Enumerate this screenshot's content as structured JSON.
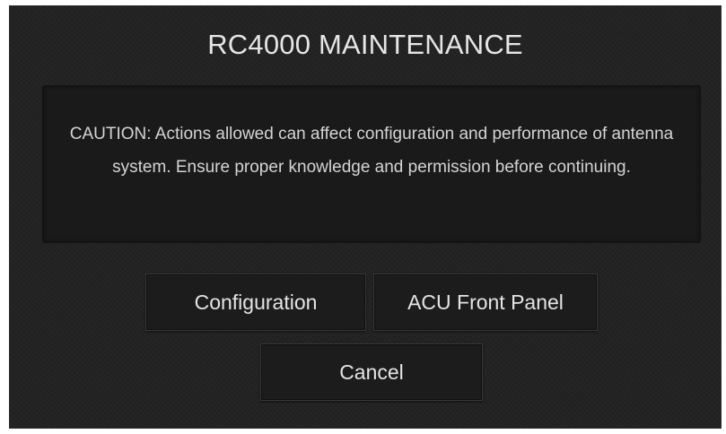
{
  "dialog": {
    "title": "RC4000 MAINTENANCE",
    "caution": "CAUTION: Actions allowed can affect configuration and performance of antenna system. Ensure proper knowledge and permission before continuing.",
    "buttons": {
      "configuration": "Configuration",
      "acu_front_panel": "ACU Front Panel",
      "cancel": "Cancel"
    }
  },
  "colors": {
    "dialog_background": "#232323",
    "caution_background": "#1a1a1a",
    "text": "#e6e6e6"
  }
}
